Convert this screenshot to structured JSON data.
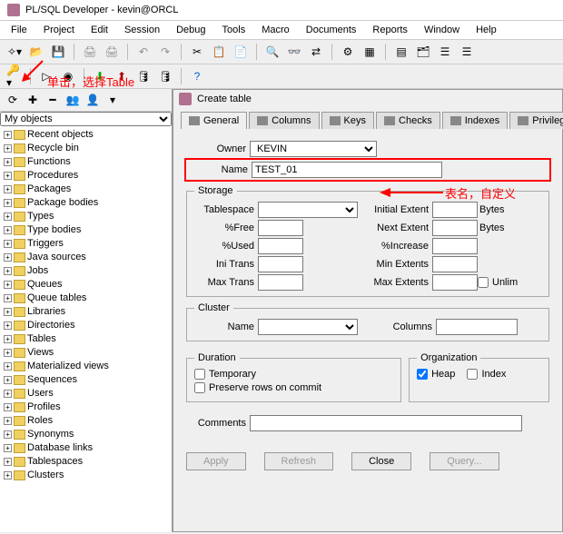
{
  "titlebar": {
    "text": "PL/SQL Developer - kevin@ORCL"
  },
  "menu": [
    "File",
    "Project",
    "Edit",
    "Session",
    "Debug",
    "Tools",
    "Macro",
    "Documents",
    "Reports",
    "Window",
    "Help"
  ],
  "annotations": {
    "a1": "单击，选择Table",
    "a2": "表名，自定义"
  },
  "sidebar": {
    "selector": "My objects",
    "items": [
      "Recent objects",
      "Recycle bin",
      "Functions",
      "Procedures",
      "Packages",
      "Package bodies",
      "Types",
      "Type bodies",
      "Triggers",
      "Java sources",
      "Jobs",
      "Queues",
      "Queue tables",
      "Libraries",
      "Directories",
      "Tables",
      "Views",
      "Materialized views",
      "Sequences",
      "Users",
      "Profiles",
      "Roles",
      "Synonyms",
      "Database links",
      "Tablespaces",
      "Clusters"
    ]
  },
  "panel": {
    "title": "Create table",
    "tabs": [
      "General",
      "Columns",
      "Keys",
      "Checks",
      "Indexes",
      "Privileges"
    ],
    "form": {
      "owner_label": "Owner",
      "owner_value": "KEVIN",
      "name_label": "Name",
      "name_value": "TEST_01",
      "storage": {
        "legend": "Storage",
        "tablespace": "Tablespace",
        "free": "%Free",
        "used": "%Used",
        "initrans": "Ini Trans",
        "maxtrans": "Max Trans",
        "initext": "Initial Extent",
        "nextext": "Next Extent",
        "incr": "%Increase",
        "minext": "Min Extents",
        "maxext": "Max Extents",
        "bytes": "Bytes",
        "unlimited": "Unlim"
      },
      "cluster": {
        "legend": "Cluster",
        "name": "Name",
        "columns": "Columns"
      },
      "duration": {
        "legend": "Duration",
        "temp": "Temporary",
        "preserve": "Preserve rows on commit"
      },
      "org": {
        "legend": "Organization",
        "heap": "Heap",
        "index": "Index"
      },
      "comments": "Comments"
    },
    "buttons": {
      "apply": "Apply",
      "refresh": "Refresh",
      "close": "Close",
      "query": "Query..."
    }
  }
}
